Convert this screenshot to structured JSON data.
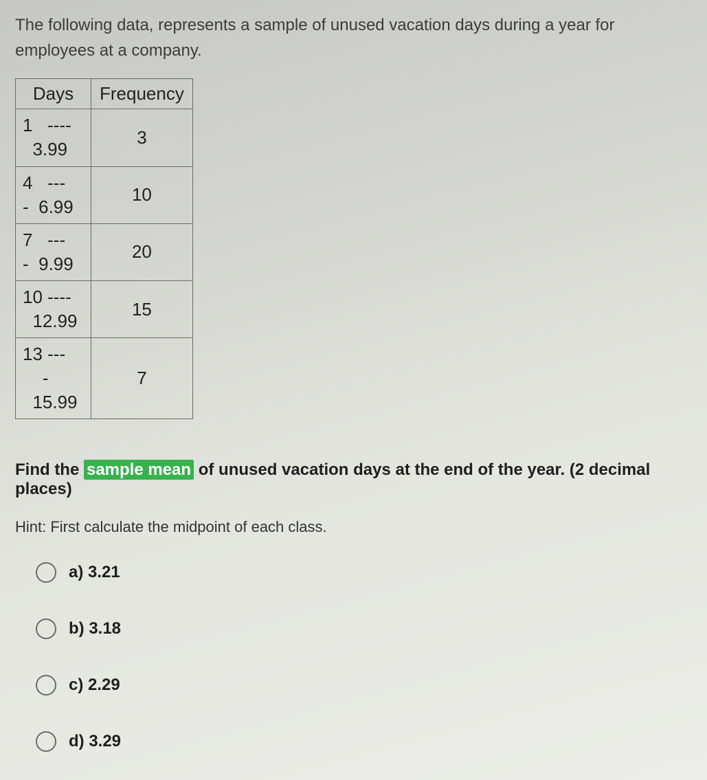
{
  "intro": "The following data, represents a sample of  unused vacation days during a year for employees at a company.",
  "table": {
    "headers": {
      "days": "Days",
      "freq": "Frequency"
    },
    "rows": [
      {
        "r1": "1   ----",
        "r2": "  3.99",
        "freq": "3"
      },
      {
        "r1": "4   ---",
        "r2": "-  6.99",
        "freq": "10"
      },
      {
        "r1": "7   ---",
        "r2": "-  9.99",
        "freq": "20"
      },
      {
        "r1": "10 ----",
        "r2": "  12.99",
        "freq": "15"
      },
      {
        "r1": "13 ---",
        "r2": "    -\n  15.99",
        "freq": "7"
      }
    ]
  },
  "question": {
    "before": "Find the ",
    "highlight": "sample mean",
    "after": " of unused vacation days at the end of the year. (2 decimal places)"
  },
  "hint": "Hint: First calculate the midpoint of each class.",
  "options": [
    {
      "label": "a)  3.21"
    },
    {
      "label": "b)  3.18"
    },
    {
      "label": "c)  2.29"
    },
    {
      "label": "d)  3.29"
    }
  ]
}
